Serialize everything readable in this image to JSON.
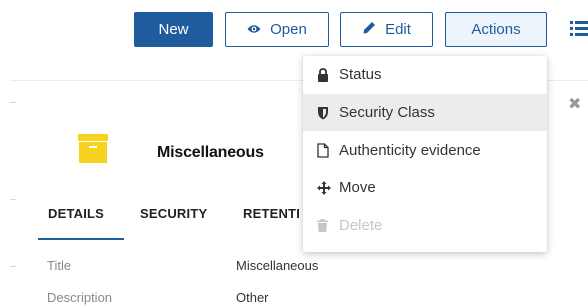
{
  "toolbar": {
    "new_label": "New",
    "open_label": "Open",
    "edit_label": "Edit",
    "actions_label": "Actions"
  },
  "actions_menu": {
    "items": [
      {
        "label": "Status",
        "icon": "lock-icon",
        "state": "normal"
      },
      {
        "label": "Security Class",
        "icon": "shield-icon",
        "state": "hover"
      },
      {
        "label": "Authenticity evidence",
        "icon": "document-icon",
        "state": "normal"
      },
      {
        "label": "Move",
        "icon": "move-arrows-icon",
        "state": "normal"
      },
      {
        "label": "Delete",
        "icon": "trash-icon",
        "state": "disabled"
      }
    ]
  },
  "record": {
    "title": "Miscellaneous",
    "icon": "folder-box-icon"
  },
  "tabs": {
    "details": "DETAILS",
    "security": "SECURITY",
    "retention": "RETENTION",
    "active": "DETAILS"
  },
  "fields": [
    {
      "label": "Title",
      "value": "Miscellaneous"
    },
    {
      "label": "Description",
      "value": "Other"
    }
  ],
  "colors": {
    "primary": "#1f5c9e",
    "folder": "#f7d21e",
    "hover": "#ececec",
    "disabled": "#c6c6c6"
  }
}
